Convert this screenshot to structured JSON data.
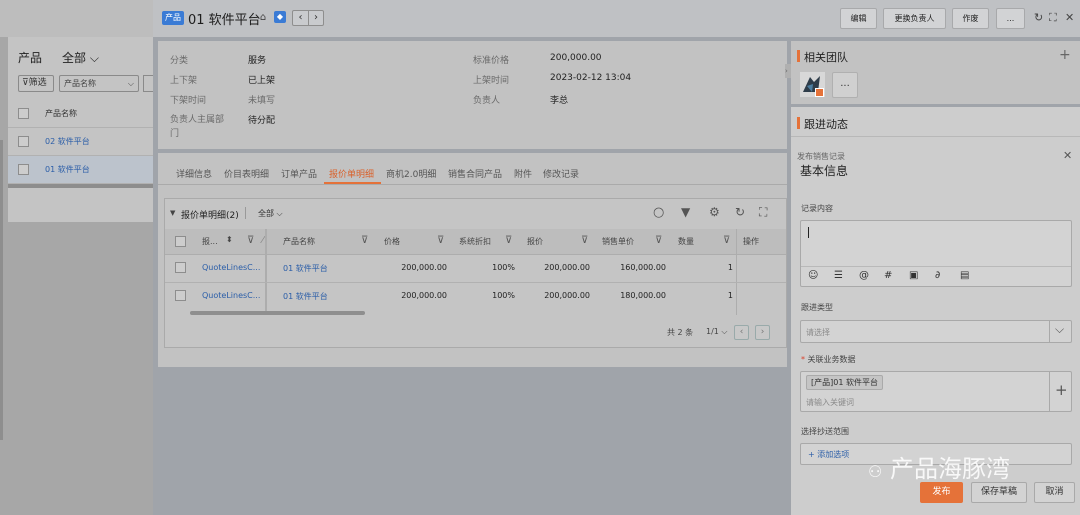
{
  "left": {
    "title": "产品",
    "filter_all": "全部",
    "filter_btn": "筛选",
    "filter_field": "产品名称",
    "col_header": "产品名称",
    "rows": [
      "02 软件平台",
      "01 软件平台"
    ]
  },
  "header": {
    "tag": "产品",
    "title": "01 软件平台",
    "buttons": [
      "编辑",
      "更换负责人",
      "作废",
      "..."
    ]
  },
  "info": {
    "fields": [
      {
        "label": "分类",
        "value": "服务"
      },
      {
        "label": "上下架",
        "value": "已上架"
      },
      {
        "label": "下架时间",
        "value": "未填写"
      },
      {
        "label": "负责人主属部门",
        "value": "待分配"
      },
      {
        "label": "标准价格",
        "value": "200,000.00"
      },
      {
        "label": "上架时间",
        "value": "2023-02-12 13:04"
      },
      {
        "label": "负责人",
        "value": "李总"
      }
    ]
  },
  "tabs": [
    "详细信息",
    "价目表明细",
    "订单产品",
    "报价单明细",
    "商机2.0明细",
    "销售合同产品",
    "附件",
    "修改记录"
  ],
  "active_tab": "报价单明细",
  "table": {
    "title": "报价单明细(2)",
    "filter": "全部",
    "headers": [
      "报...",
      "产品名称",
      "价格",
      "系统折扣",
      "报价",
      "销售单价",
      "数量",
      "操作"
    ],
    "rows": [
      {
        "quote": "QuoteLinesC...",
        "product": "01 软件平台",
        "price": "200,000.00",
        "discount": "100%",
        "offer": "200,000.00",
        "unit": "160,000.00",
        "qty": "1"
      },
      {
        "quote": "QuoteLinesC...",
        "product": "01 软件平台",
        "price": "200,000.00",
        "discount": "100%",
        "offer": "200,000.00",
        "unit": "180,000.00",
        "qty": "1"
      }
    ],
    "total": "共 2 条",
    "page": "1/1"
  },
  "team": {
    "title": "相关团队",
    "more": "..."
  },
  "follow": {
    "title": "跟进动态",
    "subtitle": "发布销售记录",
    "form_title": "基本信息",
    "content_label": "记录内容",
    "type_label": "跟进类型",
    "type_placeholder": "请选择",
    "related_label": "关联业务数据",
    "related_chip": "[产品]01 软件平台",
    "related_placeholder": "请输入关键词",
    "cc_label": "选择抄送范围",
    "cc_add": "+ 添加选项",
    "publish": "发布",
    "save_draft": "保存草稿",
    "cancel": "取消"
  },
  "watermark": "产品海豚湾",
  "colors": {
    "accent": "#e57239",
    "link": "#2b5ea8",
    "tag": "#3a7bd5"
  }
}
